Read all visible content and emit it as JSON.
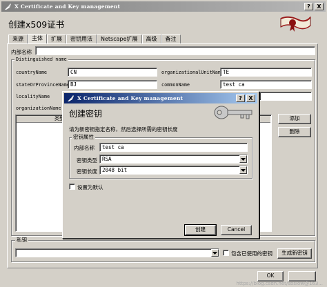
{
  "window": {
    "title": "X Certificate and Key management",
    "help_btn": "?",
    "close_btn": "X"
  },
  "main": {
    "title": "创建x509证书",
    "tabs": [
      {
        "label": "来源"
      },
      {
        "label": "主体"
      },
      {
        "label": "扩展"
      },
      {
        "label": "密钥用法"
      },
      {
        "label": "Netscape扩展"
      },
      {
        "label": "高级"
      },
      {
        "label": "备注"
      }
    ],
    "internal_name_label": "内部名称",
    "internal_name_value": "",
    "dn_group_title": "Distinguished name",
    "dn_fields": {
      "countryName_label": "countryName",
      "countryName_value": "CN",
      "ou_label": "organizationalUnitName",
      "ou_value": "TE",
      "state_label": "stateOrProvinceName",
      "state_value": "BJ",
      "cn_label": "commonName",
      "cn_value": "test ca",
      "locality_label": "localityName",
      "org_label": "organizationName"
    },
    "list_header": "类型",
    "add_button": "添加",
    "delete_button": "删除",
    "private_key_group_title": "私钥",
    "private_key_value": "",
    "include_used_keys_label": "包含已使用的密钥",
    "generate_key_button": "生成新密钥",
    "ok_button": "OK",
    "watermark": "https://blog.csdn.net/sbslow@163..."
  },
  "dialog": {
    "title": "X Certificate and Key management",
    "help_btn": "?",
    "close_btn": "X",
    "heading": "创建密钥",
    "instruction": "请为新密钥指定名称，然后选择所需的密钥长度",
    "group_title": "密钥属性",
    "name_label": "内部名称",
    "name_value": "test ca",
    "type_label": "密钥类型",
    "type_value": "RSA",
    "length_label": "密钥长度",
    "length_value": "2048 bit",
    "default_checkbox_label": "设置为默认",
    "create_button": "创建",
    "cancel_button": "Cancel"
  },
  "colors": {
    "title_active_start": "#0a246a",
    "title_active_end": "#a6caf0",
    "title_inactive": "#808080",
    "face": "#d4d0c8"
  }
}
